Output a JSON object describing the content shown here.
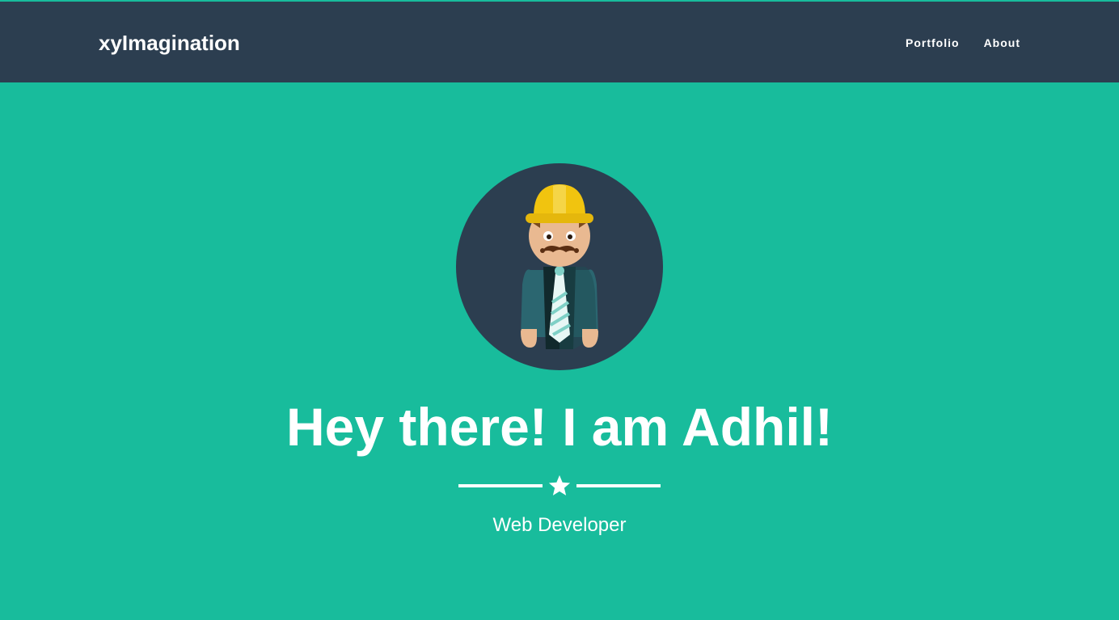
{
  "navbar": {
    "brand": "xyImagination",
    "links": [
      {
        "label": "Portfolio"
      },
      {
        "label": "About"
      }
    ]
  },
  "hero": {
    "headline": "Hey there! I am Adhil!",
    "subtitle": "Web Developer",
    "avatar_icon": "construction-worker-avatar",
    "divider_icon": "star-icon"
  },
  "colors": {
    "navbar_bg": "#2c3e50",
    "hero_bg": "#18bc9c",
    "text": "#ffffff",
    "avatar_bg": "#2c3e50",
    "helmet": "#f1c40f"
  }
}
